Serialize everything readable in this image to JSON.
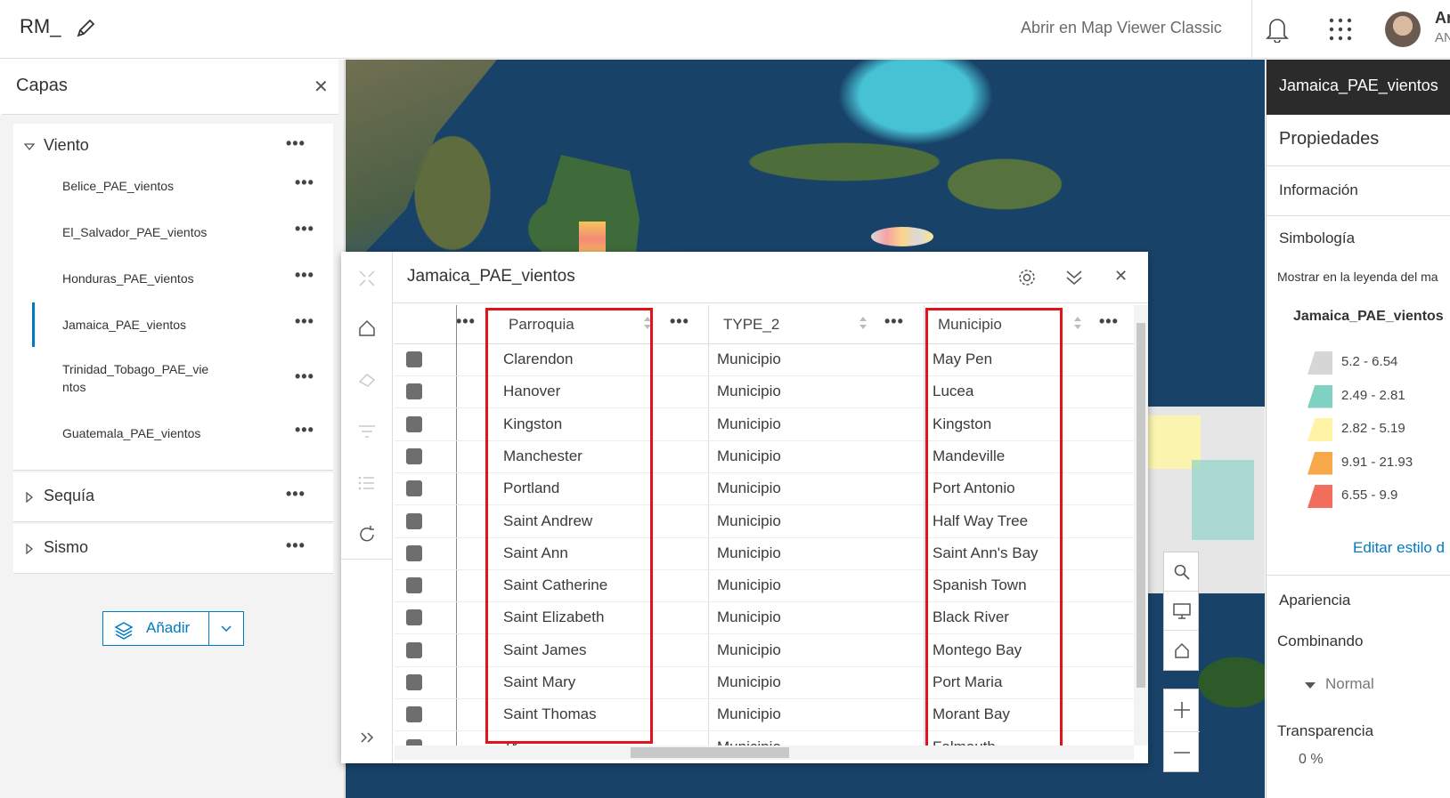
{
  "topbar": {
    "title": "RM_",
    "classic_link": "Abrir en Map Viewer Classic",
    "user_name": "An",
    "user_org": "AN"
  },
  "layers_panel": {
    "title": "Capas",
    "groups": [
      {
        "name": "Viento",
        "expanded": true,
        "layers": [
          "Belice_PAE_vientos",
          "El_Salvador_PAE_vientos",
          "Honduras_PAE_vientos",
          "Jamaica_PAE_vientos",
          "Trinidad_Tobago_PAE_vie ntos",
          "Guatemala_PAE_vientos"
        ]
      },
      {
        "name": "Sequía",
        "expanded": false
      },
      {
        "name": "Sismo",
        "expanded": false
      }
    ],
    "add_label": "Añadir"
  },
  "table": {
    "title": "Jamaica_PAE_vientos",
    "columns": [
      "Parroquia",
      "TYPE_2",
      "Municipio"
    ],
    "rows": [
      [
        "Clarendon",
        "Municipio",
        "May Pen"
      ],
      [
        "Hanover",
        "Municipio",
        "Lucea"
      ],
      [
        "Kingston",
        "Municipio",
        "Kingston"
      ],
      [
        "Manchester",
        "Municipio",
        "Mandeville"
      ],
      [
        "Portland",
        "Municipio",
        "Port Antonio"
      ],
      [
        "Saint Andrew",
        "Municipio",
        "Half Way Tree"
      ],
      [
        "Saint Ann",
        "Municipio",
        "Saint Ann's Bay"
      ],
      [
        "Saint Catherine",
        "Municipio",
        "Spanish Town"
      ],
      [
        "Saint Elizabeth",
        "Municipio",
        "Black River"
      ],
      [
        "Saint James",
        "Municipio",
        "Montego Bay"
      ],
      [
        "Saint Mary",
        "Municipio",
        "Port Maria"
      ],
      [
        "Saint Thomas",
        "Municipio",
        "Morant Bay"
      ],
      [
        "Tr",
        "Municipio",
        "Falmouth"
      ]
    ],
    "highlight_color": "#e3131b"
  },
  "properties_panel": {
    "header": "Jamaica_PAE_vientos",
    "title": "Propiedades",
    "info": "Información",
    "symbology": "Simbología",
    "legend_toggle": "Mostrar en la leyenda del ma",
    "legend_layer": "Jamaica_PAE_vientos",
    "legend": [
      {
        "label": "5.2 - 6.54",
        "color": "#d6d6d6"
      },
      {
        "label": "2.49 - 2.81",
        "color": "#7fd1c2"
      },
      {
        "label": "2.82 - 5.19",
        "color": "#fff3a6"
      },
      {
        "label": "9.91 - 21.93",
        "color": "#f7a84b"
      },
      {
        "label": "6.55 - 9.9",
        "color": "#f26d5b"
      }
    ],
    "edit_style": "Editar estilo d",
    "appearance": "Apariencia",
    "blending": "Combinando",
    "blend_value": "Normal",
    "transparency": "Transparencia",
    "transparency_value": "0 %"
  },
  "colors": {
    "accent": "#007ac2",
    "dark_header": "#2b2b2b"
  }
}
